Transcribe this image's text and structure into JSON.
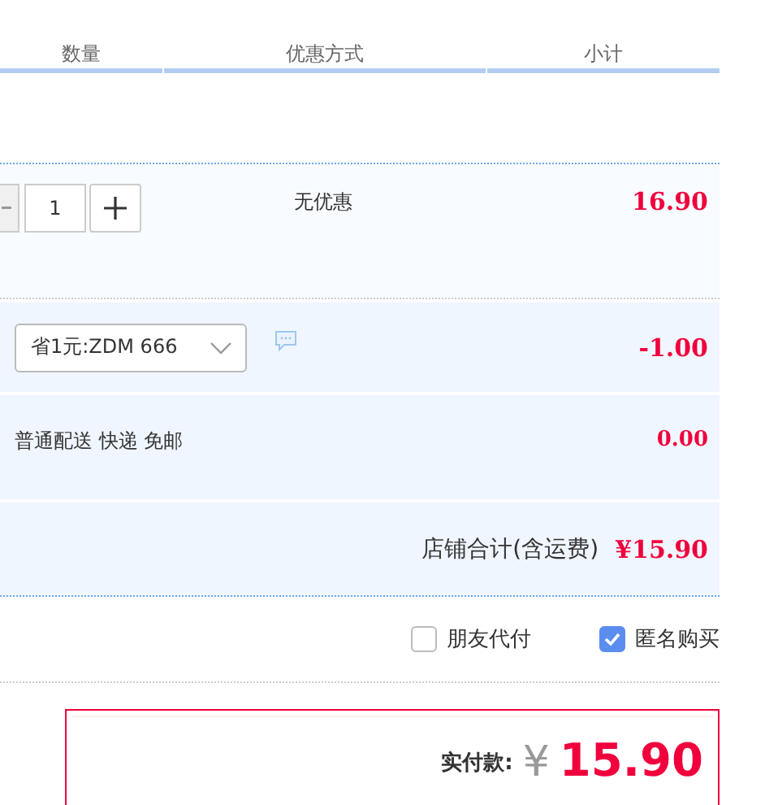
{
  "table": {
    "columns": [
      "数量",
      "优惠方式",
      "小计"
    ]
  },
  "item": {
    "quantity": "1",
    "discount": "无优惠",
    "subtotal": "16.90"
  },
  "coupon": {
    "value": "省1元:ZDM 666",
    "amount": "-1.00"
  },
  "shipping": {
    "label": "普通配送 快递 免邮",
    "amount": "0.00"
  },
  "shop_total": {
    "label": "店铺合计(含运费)",
    "amount": "¥15.90"
  },
  "options": [
    {
      "label": "朋友代付",
      "checked": false
    },
    {
      "label": "匿名购买",
      "checked": true
    }
  ],
  "payment": {
    "label": "实付款:",
    "currency": "¥",
    "amount": "15.90"
  }
}
